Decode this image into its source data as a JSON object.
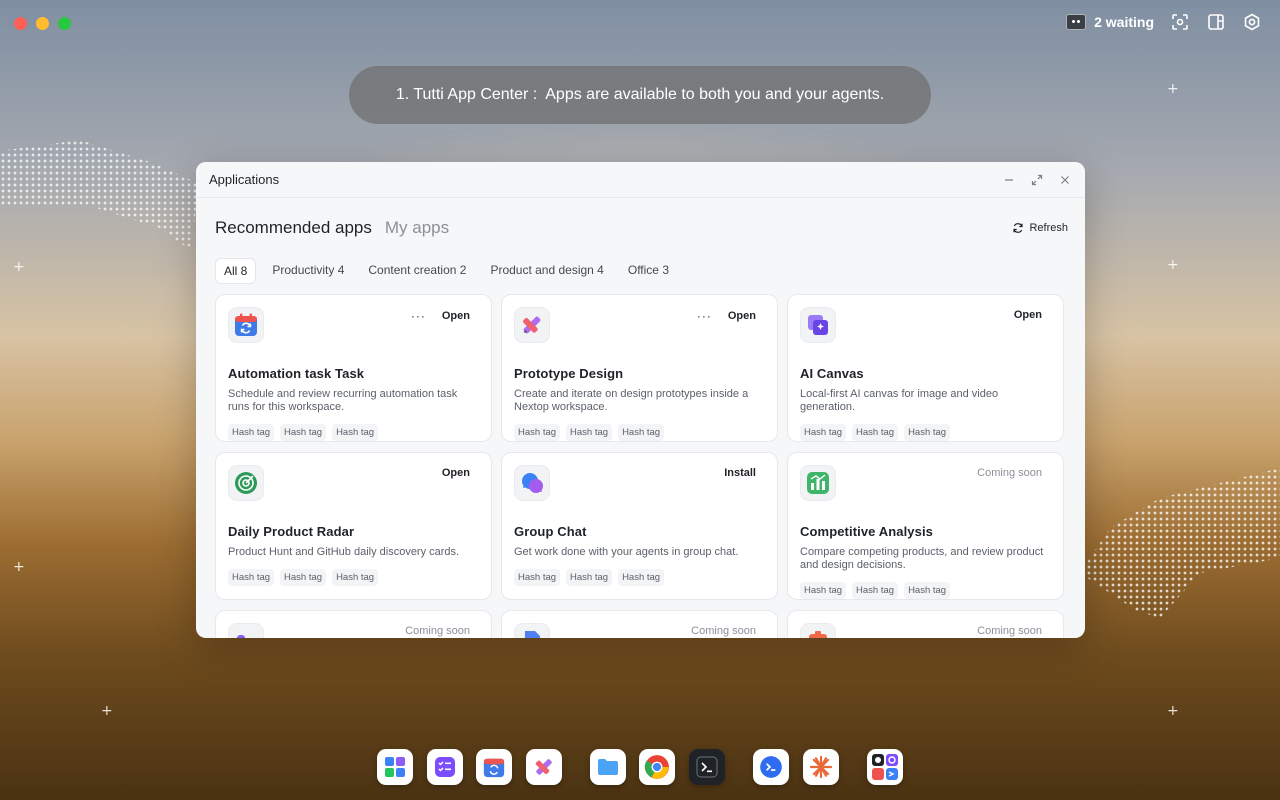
{
  "desktop": {
    "window_controls": [
      "close",
      "minimize",
      "maximize"
    ],
    "status": {
      "waiting_label": "2 waiting",
      "icon": "robot-icon"
    },
    "top_icons": [
      "scan-icon",
      "layout-panel-icon",
      "settings-icon"
    ]
  },
  "banner": {
    "text": "1. Tutti App Center :  Apps are available to both you and your agents."
  },
  "window": {
    "title": "Applications",
    "controls": [
      "minimize-icon",
      "expand-icon",
      "close-icon"
    ],
    "tabs": [
      {
        "label": "Recommended apps",
        "active": true
      },
      {
        "label": "My apps",
        "active": false
      }
    ],
    "refresh_label": "Refresh",
    "filters": [
      {
        "label": "All 8",
        "active": true
      },
      {
        "label": "Productivity 4",
        "active": false
      },
      {
        "label": "Content creation 2",
        "active": false
      },
      {
        "label": "Product and design 4",
        "active": false
      },
      {
        "label": "Office 3",
        "active": false
      }
    ],
    "apps": [
      {
        "name": "Automation task Task",
        "description": "Schedule and review recurring automation task runs for this workspace.",
        "action": "Open",
        "more": "···",
        "icon": "calendar-refresh-icon",
        "tags": [
          "Hash tag",
          "Hash tag",
          "Hash tag"
        ]
      },
      {
        "name": "Prototype Design",
        "description": "Create and iterate on design prototypes inside a Nextop workspace.",
        "action": "Open",
        "more": "···",
        "icon": "pen-ruler-icon",
        "tags": [
          "Hash tag",
          "Hash tag",
          "Hash tag"
        ]
      },
      {
        "name": "AI Canvas",
        "description": "Local-first AI canvas for image and video generation.",
        "action": "Open",
        "icon": "canvas-sparkle-icon",
        "tags": [
          "Hash tag",
          "Hash tag",
          "Hash tag"
        ]
      },
      {
        "name": "Daily Product Radar",
        "description": "Product Hunt and GitHub daily discovery cards.",
        "action": "Open",
        "icon": "radar-icon",
        "tags": [
          "Hash tag",
          "Hash tag",
          "Hash tag"
        ]
      },
      {
        "name": "Group Chat",
        "description": "Get work done with your agents in group chat.",
        "action": "Install",
        "icon": "chat-bubbles-icon",
        "tags": [
          "Hash tag",
          "Hash tag",
          "Hash tag"
        ]
      },
      {
        "name": "Competitive Analysis",
        "description": "Compare competing products, and review product and design decisions.",
        "action": "Coming soon",
        "icon": "bar-chart-icon",
        "tags": [
          "Hash tag",
          "Hash tag",
          "Hash tag"
        ]
      },
      {
        "name": "",
        "description": "",
        "action": "Coming soon",
        "icon": "purple-blocks-icon",
        "tags": []
      },
      {
        "name": "",
        "description": "",
        "action": "Coming soon",
        "icon": "document-icon",
        "tags": []
      },
      {
        "name": "",
        "description": "",
        "action": "Coming soon",
        "icon": "orange-slides-icon",
        "tags": []
      }
    ]
  },
  "dock": {
    "items": [
      "app-grid-icon",
      "checklist-icon",
      "calendar-refresh-icon",
      "pen-ruler-icon",
      "folder-icon",
      "chrome-icon",
      "terminal-icon",
      "code-chat-icon",
      "burst-icon",
      "tools-cluster-icon"
    ]
  },
  "colors": {
    "accent_purple": "#7b5cf0",
    "calendar_blue": "#3f7be8",
    "radar_green": "#2e9a5a",
    "chart_green": "#3fb56a",
    "action_text": "#1f2328",
    "muted_text": "#8b9098"
  }
}
